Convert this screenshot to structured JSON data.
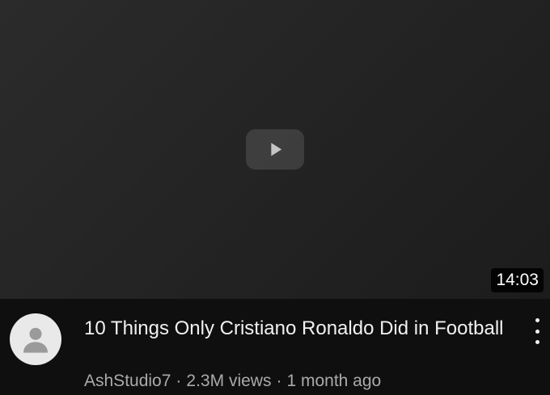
{
  "video": {
    "duration": "14:03",
    "title": "10 Things Only Cristiano Ronaldo Did in Football",
    "channel": "AshStudio7",
    "views": "2.3M views",
    "age": "1 month ago",
    "separator": "·"
  },
  "icons": {
    "thumbnail": "play-icon",
    "avatar": "user-icon",
    "menu": "more-vert-icon"
  },
  "colors": {
    "background": "#0f0f0f",
    "title_text": "#f1f1f1",
    "meta_text": "#aaaaaa"
  }
}
